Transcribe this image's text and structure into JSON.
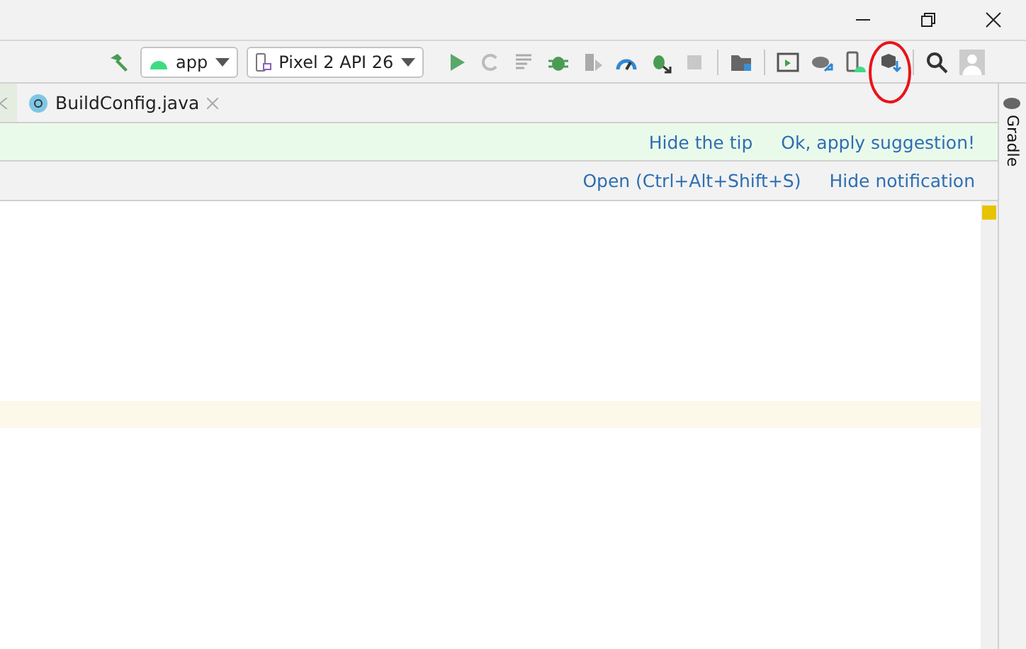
{
  "toolbar": {
    "run_config": "app",
    "device": "Pixel 2 API 26"
  },
  "tabs": [
    {
      "label": "BuildConfig.java",
      "selected": true
    }
  ],
  "tip_banner": {
    "links": [
      "Hide the tip",
      "Ok, apply suggestion!"
    ]
  },
  "notification": {
    "links": [
      "Open (Ctrl+Alt+Shift+S)",
      "Hide notification"
    ]
  },
  "side_panel": {
    "label": "Gradle"
  }
}
